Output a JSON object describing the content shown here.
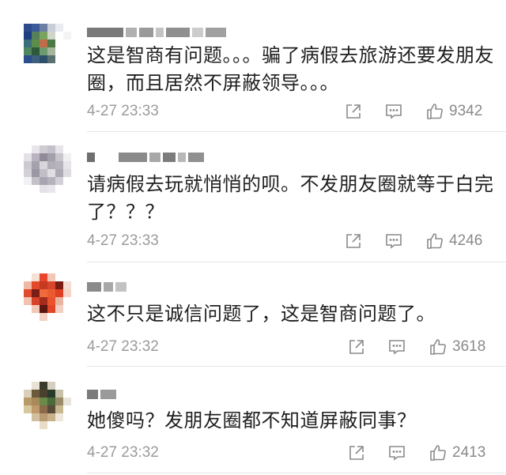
{
  "comments": [
    {
      "text": "这是智商有问题。。。骗了病假去旅游还要发朋友圈，而且居然不屏蔽领导。。。",
      "time": "4-27 23:33",
      "likes": "9342"
    },
    {
      "text": "请病假去玩就悄悄的呗。不发朋友圈就等于白完了？？？",
      "time": "4-27 23:33",
      "likes": "4246"
    },
    {
      "text": "这不只是诚信问题了，这是智商问题了。",
      "time": "4-27 23:32",
      "likes": "3618"
    },
    {
      "text": "她傻吗？发朋友圈都不知道屏蔽同事？",
      "time": "4-27 23:32",
      "likes": "2413"
    }
  ],
  "icons": {
    "share": "share-icon",
    "reply": "comment-icon",
    "like": "thumbs-up-icon"
  },
  "colors": {
    "text": "#1f1f1f",
    "meta": "#9b9b9b",
    "divider": "#e6e6e6"
  }
}
